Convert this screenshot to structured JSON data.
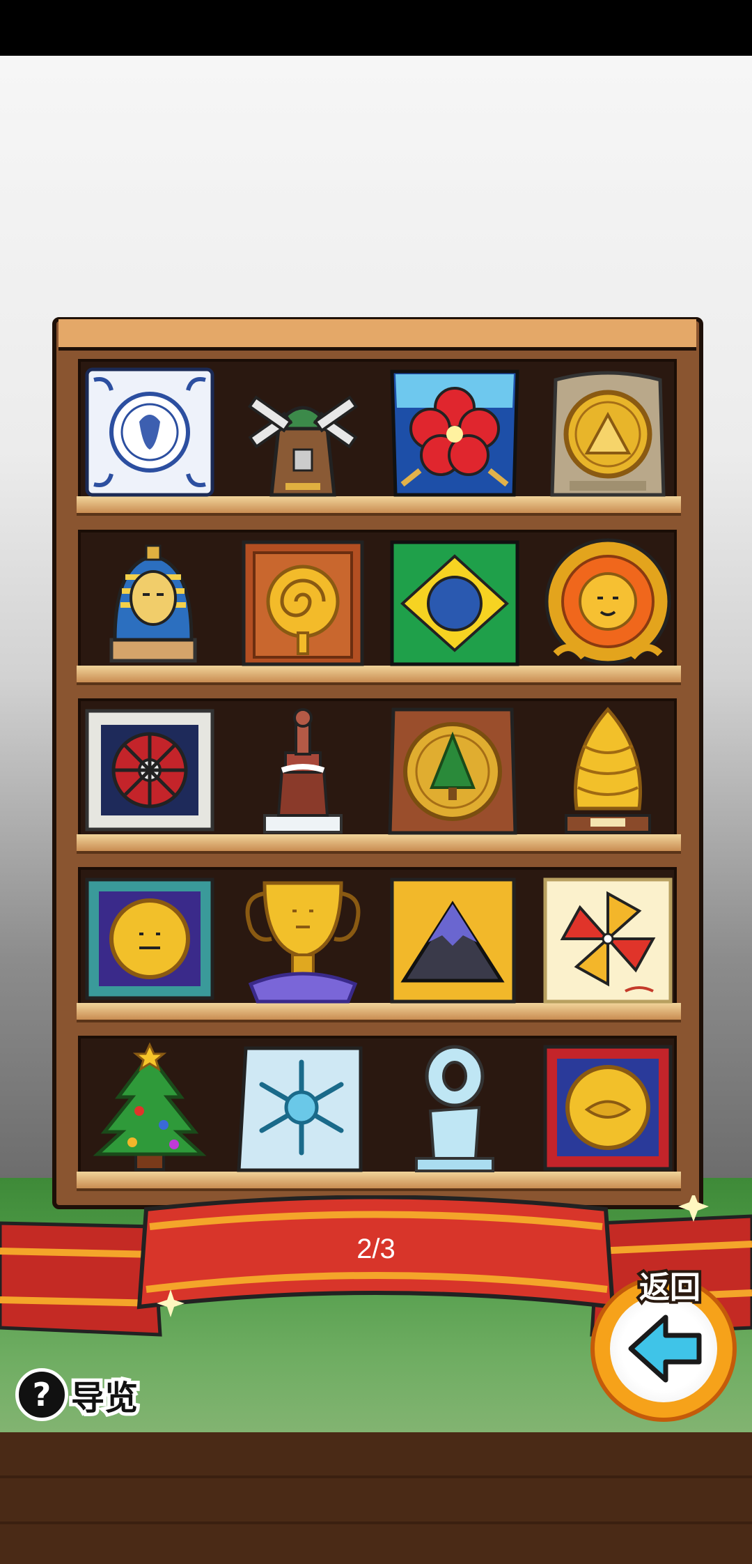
{
  "status_bar": {},
  "shelf": {
    "rows": [
      [
        "delft-tile-icon",
        "windmill-icon",
        "hibiscus-panel-icon",
        "stone-coin-plaque-icon"
      ],
      [
        "pharaoh-bust-icon",
        "spiral-wood-plaque-icon",
        "brazil-flag-icon",
        "lion-medal-icon"
      ],
      [
        "wheel-frame-icon",
        "monument-statue-icon",
        "sequoia-coin-plaque-icon",
        "golden-pinecone-icon"
      ],
      [
        "framed-coin-icon",
        "gold-trophy-icon",
        "mountain-plaque-icon",
        "pinwheel-card-icon"
      ],
      [
        "christmas-tree-icon",
        "snowflake-panel-icon",
        "crystal-trophy-icon",
        "red-frame-coin-icon"
      ]
    ]
  },
  "pagination": {
    "text": "2/3"
  },
  "back_button": {
    "label": "返回",
    "icon": "left-arrow-icon"
  },
  "guide_button": {
    "icon_text": "?",
    "label": "导览"
  },
  "colors": {
    "ribbon": "#d8352a",
    "ribbon_trim": "#f4a52a",
    "shelf_wood": "#8a5530",
    "back_arrow": "#3fc4e8"
  }
}
